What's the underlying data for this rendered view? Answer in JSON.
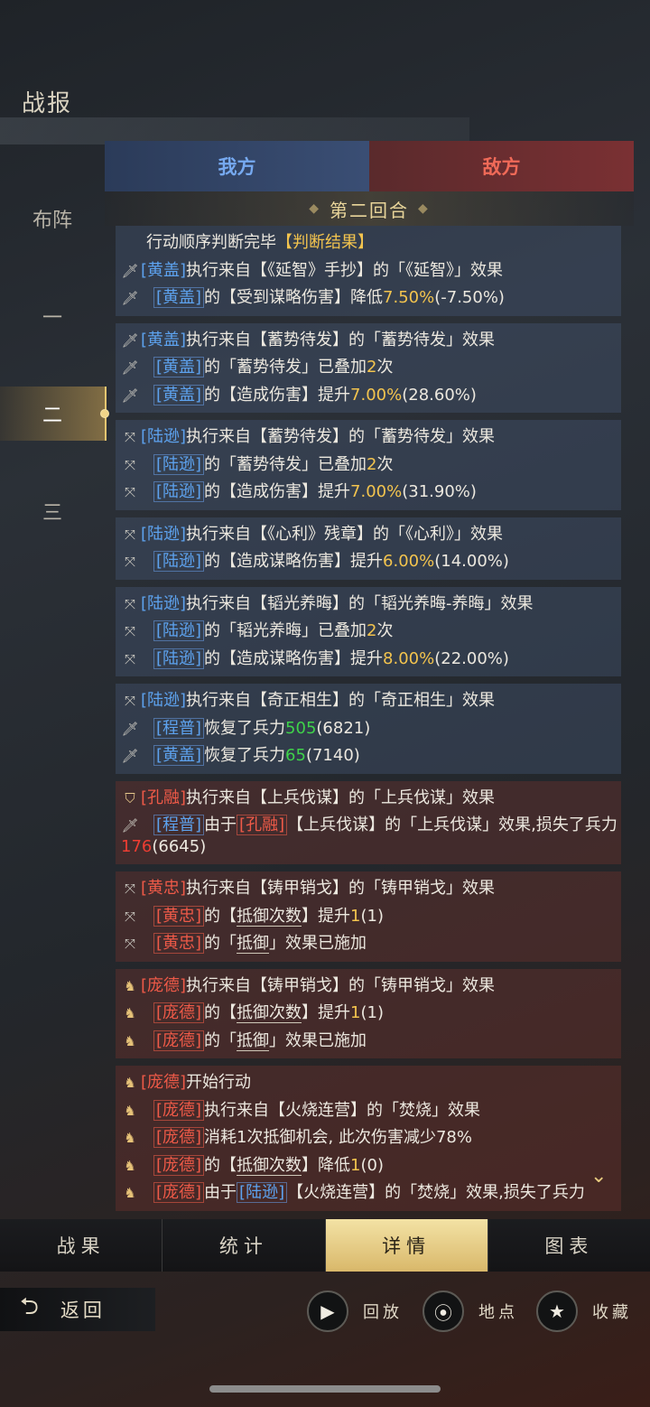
{
  "page_title": "战报",
  "rounds": [
    {
      "label": "布阵",
      "active": false
    },
    {
      "label": "一",
      "active": false
    },
    {
      "label": "二",
      "active": true
    },
    {
      "label": "三",
      "active": false
    }
  ],
  "side_tabs": {
    "ours": "我方",
    "enemy": "敌方"
  },
  "round_header": "第二回合",
  "icons": {
    "sword": "sword-icon",
    "bow": "bow-icon",
    "shield": "shield-icon",
    "horse": "horse-icon"
  },
  "log": {
    "b1": {
      "l1_pre": "行动顺序判断完毕",
      "l1_tag": "【判断结果】",
      "l2_name": "[黄盖]",
      "l2_text": "执行来自【《延智》手抄】的「《延智》」效果",
      "l3_name": "[黄盖]",
      "l3_text": "的【受到谋略伤害】降低",
      "l3_val": "7.50%",
      "l3_tail": "(-7.50%)"
    },
    "b2": {
      "l1_name": "[黄盖]",
      "l1_text": "执行来自【蓄势待发】的「蓄势待发」效果",
      "l2_name": "[黄盖]",
      "l2_text": "的「蓄势待发」已叠加",
      "l2_val": "2",
      "l2_tail": "次",
      "l3_name": "[黄盖]",
      "l3_text": "的【造成伤害】提升",
      "l3_val": "7.00%",
      "l3_tail": "(28.60%)"
    },
    "b3": {
      "l1_name": "[陆逊]",
      "l1_text": "执行来自【蓄势待发】的「蓄势待发」效果",
      "l2_name": "[陆逊]",
      "l2_text": "的「蓄势待发」已叠加",
      "l2_val": "2",
      "l2_tail": "次",
      "l3_name": "[陆逊]",
      "l3_text": "的【造成伤害】提升",
      "l3_val": "7.00%",
      "l3_tail": "(31.90%)"
    },
    "b4": {
      "l1_name": "[陆逊]",
      "l1_text": "执行来自【《心利》残章】的「《心利》」效果",
      "l2_name": "[陆逊]",
      "l2_text": "的【造成谋略伤害】提升",
      "l2_val": "6.00%",
      "l2_tail": "(14.00%)"
    },
    "b5": {
      "l1_name": "[陆逊]",
      "l1_text": "执行来自【韬光养晦】的「韬光养晦-养晦」效果",
      "l2_name": "[陆逊]",
      "l2_text": "的「韬光养晦」已叠加",
      "l2_val": "2",
      "l2_tail": "次",
      "l3_name": "[陆逊]",
      "l3_text": "的【造成谋略伤害】提升",
      "l3_val": "8.00%",
      "l3_tail": "(22.00%)"
    },
    "b6": {
      "l1_name": "[陆逊]",
      "l1_text": "执行来自【奇正相生】的「奇正相生」效果",
      "l2_name": "[程普]",
      "l2_text": "恢复了兵力",
      "l2_val": "505",
      "l2_tail": "(6821)",
      "l3_name": "[黄盖]",
      "l3_text": "恢复了兵力",
      "l3_val": "65",
      "l3_tail": "(7140)"
    },
    "b7": {
      "l1_name": "[孔融]",
      "l1_text": "执行来自【上兵伐谋】的「上兵伐谋」效果",
      "l2_name": "[程普]",
      "l2_mid": "由于",
      "l2_name2": "[孔融]",
      "l2_text": "【上兵伐谋】的「上兵伐谋」效果,损失了兵力",
      "l2_val": "176",
      "l2_tail": "(6645)"
    },
    "b8": {
      "l1_name": "[黄忠]",
      "l1_text": "执行来自【铸甲销戈】的「铸甲销戈」效果",
      "l2_name": "[黄忠]",
      "l2_pre": "的【",
      "l2_key": "抵御次数",
      "l2_post": "】提升",
      "l2_val": "1",
      "l2_tail": "(1)",
      "l3_name": "[黄忠]",
      "l3_pre": "的「",
      "l3_key": "抵御",
      "l3_post": "」效果已施加"
    },
    "b9": {
      "l1_name": "[庞德]",
      "l1_text": "执行来自【铸甲销戈】的「铸甲销戈」效果",
      "l2_name": "[庞德]",
      "l2_pre": "的【",
      "l2_key": "抵御次数",
      "l2_post": "】提升",
      "l2_val": "1",
      "l2_tail": "(1)",
      "l3_name": "[庞德]",
      "l3_pre": "的「",
      "l3_key": "抵御",
      "l3_post": "」效果已施加"
    },
    "b10": {
      "l1_name": "[庞德]",
      "l1_text": "开始行动",
      "l2_name": "[庞德]",
      "l2_text": "执行来自【火烧连营】的「焚烧」效果",
      "l3_name": "[庞德]",
      "l3_text": "消耗1次抵御机会, 此次伤害减少78%",
      "l4_name": "[庞德]",
      "l4_pre": "的【",
      "l4_key": "抵御次数",
      "l4_post": "】降低",
      "l4_val": "1",
      "l4_tail": "(0)",
      "l5_name": "[庞德]",
      "l5_mid": "由于",
      "l5_name2": "[陆逊]",
      "l5_text": "【火烧连营】的「焚烧」效果,损失了兵力"
    }
  },
  "bottom_tabs": [
    {
      "label": "战果",
      "active": false
    },
    {
      "label": "统计",
      "active": false
    },
    {
      "label": "详情",
      "active": true
    },
    {
      "label": "图表",
      "active": false
    }
  ],
  "footer": {
    "back_label": "返回",
    "replay_label": "回放",
    "location_label": "地点",
    "favorite_label": "收藏"
  }
}
